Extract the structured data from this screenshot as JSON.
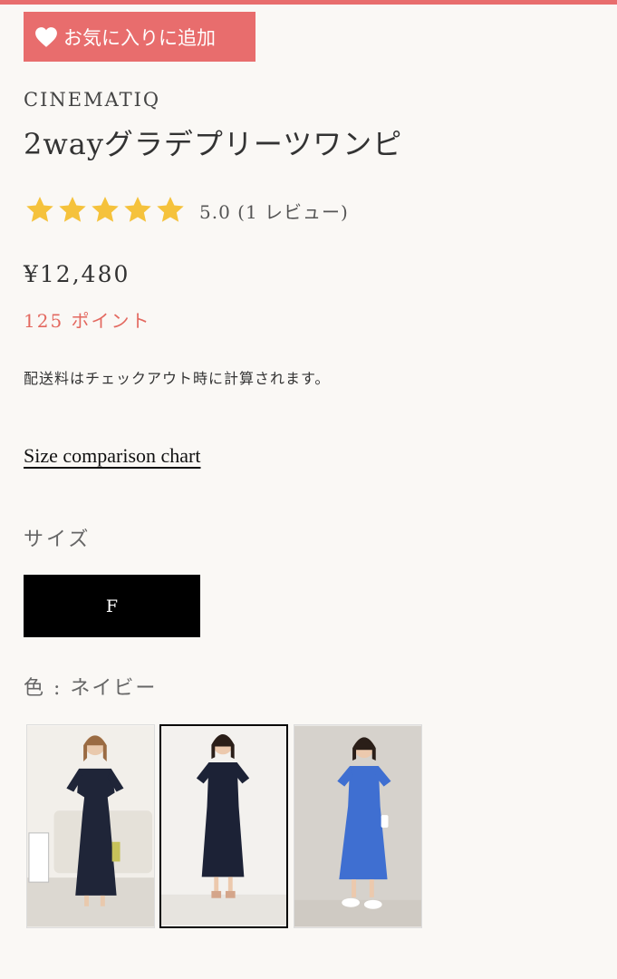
{
  "favorite": {
    "label": "お気に入りに追加",
    "icon": "heart-icon"
  },
  "product": {
    "brand": "CINEMATIQ",
    "title": "2wayグラデプリーツワンピ",
    "rating": {
      "stars": 5,
      "text": "5.0 (1 レビュー)"
    },
    "price": "¥12,480",
    "points": "125 ポイント",
    "shipping_note": "配送料はチェックアウト時に計算されます。"
  },
  "size_chart_link": "Size comparison chart",
  "size": {
    "label": "サイズ",
    "selected": "F"
  },
  "color": {
    "label": "色 : ネイビー",
    "swatches": [
      {
        "name": "navy-v-neck",
        "dress_color": "#1f2538"
      },
      {
        "name": "navy-crew-neck",
        "dress_color": "#1c2236",
        "selected": true
      },
      {
        "name": "blue",
        "dress_color": "#3f6fd1"
      }
    ]
  },
  "colors": {
    "accent": "#e86d6d",
    "points": "#e3685f",
    "star": "#f5c23c"
  }
}
